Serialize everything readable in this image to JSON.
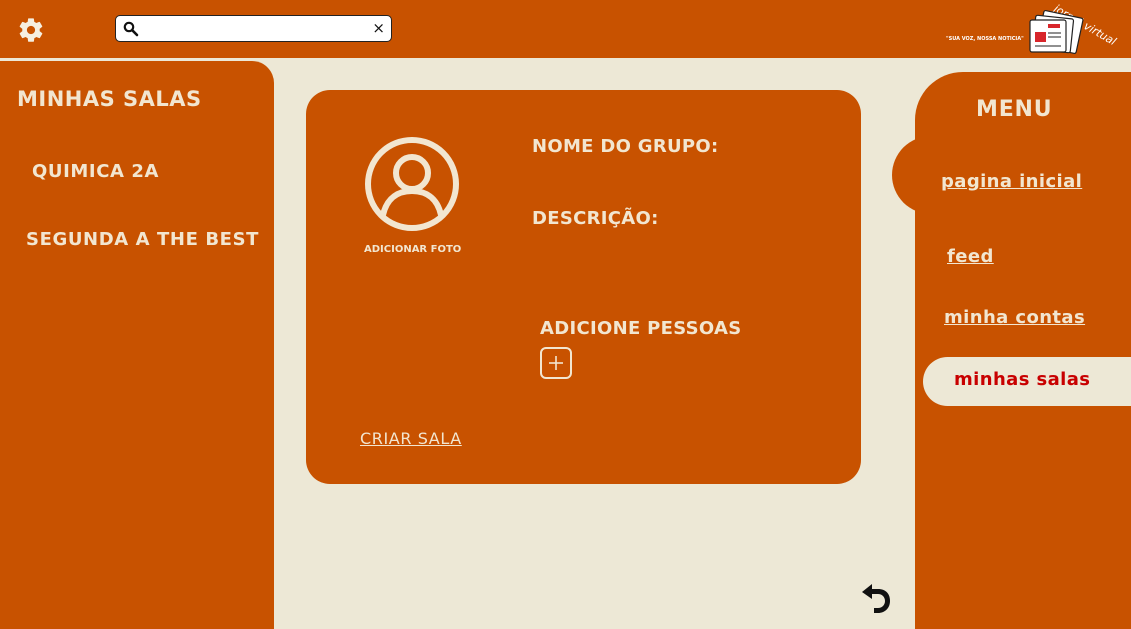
{
  "topbar": {
    "search": {
      "value": "",
      "placeholder": "",
      "clear_label": "×"
    },
    "logo": {
      "name": "jornal virtual",
      "tagline": "\"SUA VOZ, NOSSA NOTICIA\""
    }
  },
  "sidebar": {
    "title": "MINHAS SALAS",
    "items": [
      {
        "label": "QUIMICA 2A"
      },
      {
        "label": "SEGUNDA A THE BEST"
      }
    ]
  },
  "form": {
    "add_photo_label": "ADICIONAR FOTO",
    "group_name_label": "NOME DO GRUPO:",
    "description_label": "DESCRIÇÃO:",
    "add_people_label": "ADICIONE  PESSOAS",
    "create_label": "CRIAR SALA"
  },
  "menu": {
    "title": "MENU",
    "items": [
      {
        "label": "pagina inicial"
      },
      {
        "label": "feed"
      },
      {
        "label": "minha contas"
      },
      {
        "label": "minhas salas",
        "active": true
      }
    ]
  },
  "colors": {
    "accent": "#c85200",
    "background": "#ede8d6",
    "text_light": "#f2e6d0",
    "active_text": "#c80000"
  }
}
